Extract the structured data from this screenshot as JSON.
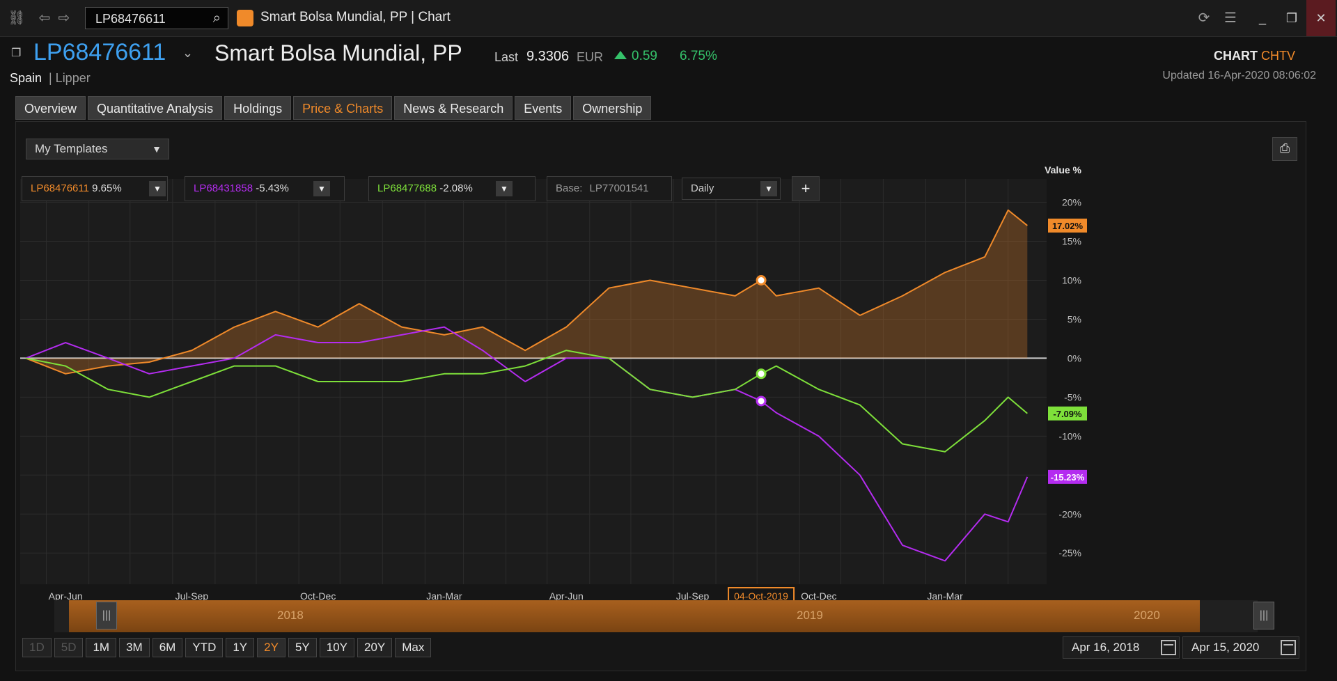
{
  "window": {
    "search_value": "LP68476611",
    "title": "Smart Bolsa Mundial, PP | Chart"
  },
  "header": {
    "ric": "LP68476611",
    "name": "Smart Bolsa Mundial, PP",
    "last_label": "Last",
    "last_value": "9.3306",
    "currency": "EUR",
    "change_abs": "0.59",
    "change_pct": "6.75%",
    "country": "Spain",
    "source": "| Lipper",
    "chart_label": "CHART",
    "chtv_label": "CHTV",
    "updated": "Updated 16-Apr-2020   08:06:02"
  },
  "tabs": [
    {
      "label": "Overview"
    },
    {
      "label": "Quantitative Analysis"
    },
    {
      "label": "Holdings"
    },
    {
      "label": "Price & Charts",
      "active": true
    },
    {
      "label": "News & Research"
    },
    {
      "label": "Events"
    },
    {
      "label": "Ownership"
    }
  ],
  "toolbar": {
    "templates": "My Templates",
    "base_label": "Base:",
    "base_value": "LP77001541",
    "interval": "Daily",
    "add_label": "+"
  },
  "series_pills": [
    {
      "code": "LP68476611",
      "value": "9.65%",
      "color": "#f08a2a"
    },
    {
      "code": "LP68431858",
      "value": "-5.43%",
      "color": "#b42cf0"
    },
    {
      "code": "LP68477688",
      "value": "-2.08%",
      "color": "#7ee03a"
    }
  ],
  "chart_data": {
    "type": "line",
    "ylabel": "Value %",
    "ylim": [
      -29,
      23
    ],
    "yticks": [
      "20%",
      "15%",
      "10%",
      "5%",
      "0%",
      "-5%",
      "-10%",
      "-15%",
      "-20%",
      "-25%"
    ],
    "ytick_values": [
      20,
      15,
      10,
      5,
      0,
      -5,
      -10,
      -15,
      -20,
      -25
    ],
    "x_period_labels": [
      "Apr-Jun",
      "Jul-Sep",
      "Oct-Dec",
      "Jan-Mar",
      "Apr-Jun",
      "Jul-Sep",
      "Oct-Dec",
      "Jan-Mar"
    ],
    "x_year_labels": [
      "2018",
      "2019",
      "2020"
    ],
    "crosshair_date": "04-Oct-2019",
    "x": [
      "2018-04-16",
      "2018-05-15",
      "2018-06-15",
      "2018-07-15",
      "2018-08-15",
      "2018-09-15",
      "2018-10-15",
      "2018-11-15",
      "2018-12-15",
      "2019-01-15",
      "2019-02-15",
      "2019-03-15",
      "2019-04-15",
      "2019-05-15",
      "2019-06-15",
      "2019-07-15",
      "2019-08-15",
      "2019-09-15",
      "2019-10-04",
      "2019-10-15",
      "2019-11-15",
      "2019-12-15",
      "2020-01-15",
      "2020-02-15",
      "2020-03-15",
      "2020-04-01",
      "2020-04-15"
    ],
    "series": [
      {
        "name": "LP68476611",
        "color": "#f08a2a",
        "last_label": "17.02%",
        "values": [
          0,
          -2,
          -1,
          -0.5,
          1,
          4,
          6,
          4,
          7,
          4,
          3,
          4,
          1,
          4,
          9,
          10,
          9,
          8,
          10,
          8,
          9,
          5.5,
          8,
          11,
          13,
          19,
          17.02
        ]
      },
      {
        "name": "LP68431858",
        "color": "#b42cf0",
        "last_label": "-15.23%",
        "values": [
          0,
          2,
          0,
          -2,
          -1,
          0,
          3,
          2,
          2,
          3,
          4,
          1,
          -3,
          0,
          0,
          -4,
          -5,
          -4,
          -5.5,
          -7,
          -10,
          -15,
          -24,
          -26,
          -20,
          -21,
          -15.23
        ]
      },
      {
        "name": "LP68477688",
        "color": "#7ee03a",
        "last_label": "-7.09%",
        "values": [
          0,
          -1,
          -4,
          -5,
          -3,
          -1,
          -1,
          -3,
          -3,
          -3,
          -2,
          -2,
          -1,
          1,
          0,
          -4,
          -5,
          -4,
          -2,
          -1,
          -4,
          -6,
          -11,
          -12,
          -8,
          -5,
          -7.09
        ]
      }
    ]
  },
  "navigator": {
    "years": [
      "2018",
      "2019",
      "2020"
    ]
  },
  "range_buttons": [
    {
      "label": "1D",
      "state": "dim"
    },
    {
      "label": "5D",
      "state": "dim"
    },
    {
      "label": "1M"
    },
    {
      "label": "3M"
    },
    {
      "label": "6M"
    },
    {
      "label": "YTD"
    },
    {
      "label": "1Y"
    },
    {
      "label": "2Y",
      "state": "active"
    },
    {
      "label": "5Y"
    },
    {
      "label": "10Y"
    },
    {
      "label": "20Y"
    },
    {
      "label": "Max"
    }
  ],
  "date_range": {
    "from": "Apr 16, 2018",
    "to": "Apr 15, 2020"
  },
  "colors": {
    "accent": "#f08a2a",
    "positive": "#35c26a",
    "link": "#3ea0f0"
  }
}
